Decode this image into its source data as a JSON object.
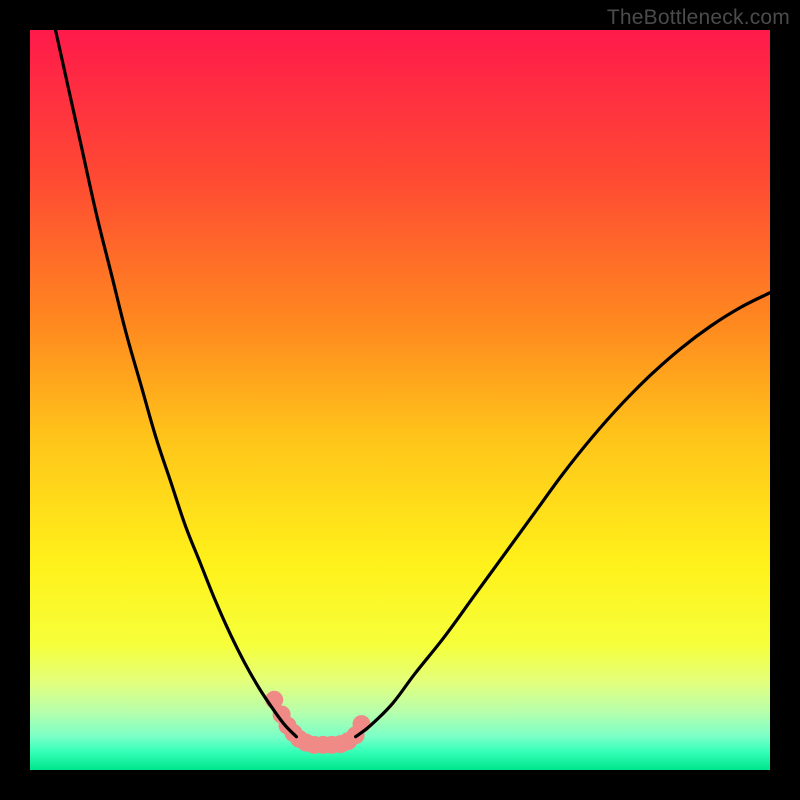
{
  "watermark": {
    "text": "TheBottleneck.com"
  },
  "chart_data": {
    "type": "line",
    "title": "",
    "xlabel": "",
    "ylabel": "",
    "xlim": [
      0,
      100
    ],
    "ylim": [
      0,
      100
    ],
    "background_gradient": {
      "direction": "vertical",
      "stops": [
        {
          "pos": 0.0,
          "color": "#ff1a4b"
        },
        {
          "pos": 0.2,
          "color": "#ff4a33"
        },
        {
          "pos": 0.4,
          "color": "#ff8a1f"
        },
        {
          "pos": 0.55,
          "color": "#ffc41a"
        },
        {
          "pos": 0.72,
          "color": "#fff11a"
        },
        {
          "pos": 0.83,
          "color": "#f6ff3a"
        },
        {
          "pos": 0.88,
          "color": "#e4ff7a"
        },
        {
          "pos": 0.92,
          "color": "#b9ffab"
        },
        {
          "pos": 0.955,
          "color": "#7affc7"
        },
        {
          "pos": 0.975,
          "color": "#35ffb8"
        },
        {
          "pos": 1.0,
          "color": "#00e58c"
        }
      ]
    },
    "series": [
      {
        "name": "left-branch",
        "style": "line",
        "color": "#000000",
        "x": [
          3,
          5,
          7,
          9,
          11,
          13,
          15,
          17,
          19,
          21,
          23,
          25,
          27,
          29,
          31,
          33,
          34.5,
          36
        ],
        "y": [
          102,
          93,
          84,
          75,
          67,
          59,
          52,
          45,
          39,
          33,
          28,
          23,
          18.5,
          14.5,
          11,
          8,
          6,
          4.5
        ]
      },
      {
        "name": "right-branch",
        "style": "line",
        "color": "#000000",
        "x": [
          44,
          46,
          49,
          52,
          56,
          60,
          64,
          68,
          72,
          76,
          80,
          84,
          88,
          92,
          96,
          100
        ],
        "y": [
          4.5,
          6,
          9,
          13,
          18,
          23.5,
          29,
          34.5,
          40,
          45,
          49.5,
          53.5,
          57,
          60,
          62.5,
          64.5
        ]
      },
      {
        "name": "floor-dots",
        "style": "dots",
        "color": "#ef8a87",
        "radius": 9,
        "x": [
          33.0,
          34.0,
          34.8,
          35.6,
          36.4,
          37.3,
          38.4,
          39.6,
          40.8,
          42.0,
          43.0,
          44.0,
          44.8
        ],
        "y": [
          9.5,
          7.5,
          6.0,
          5.0,
          4.2,
          3.7,
          3.4,
          3.4,
          3.4,
          3.5,
          3.9,
          4.7,
          6.2
        ]
      }
    ]
  }
}
